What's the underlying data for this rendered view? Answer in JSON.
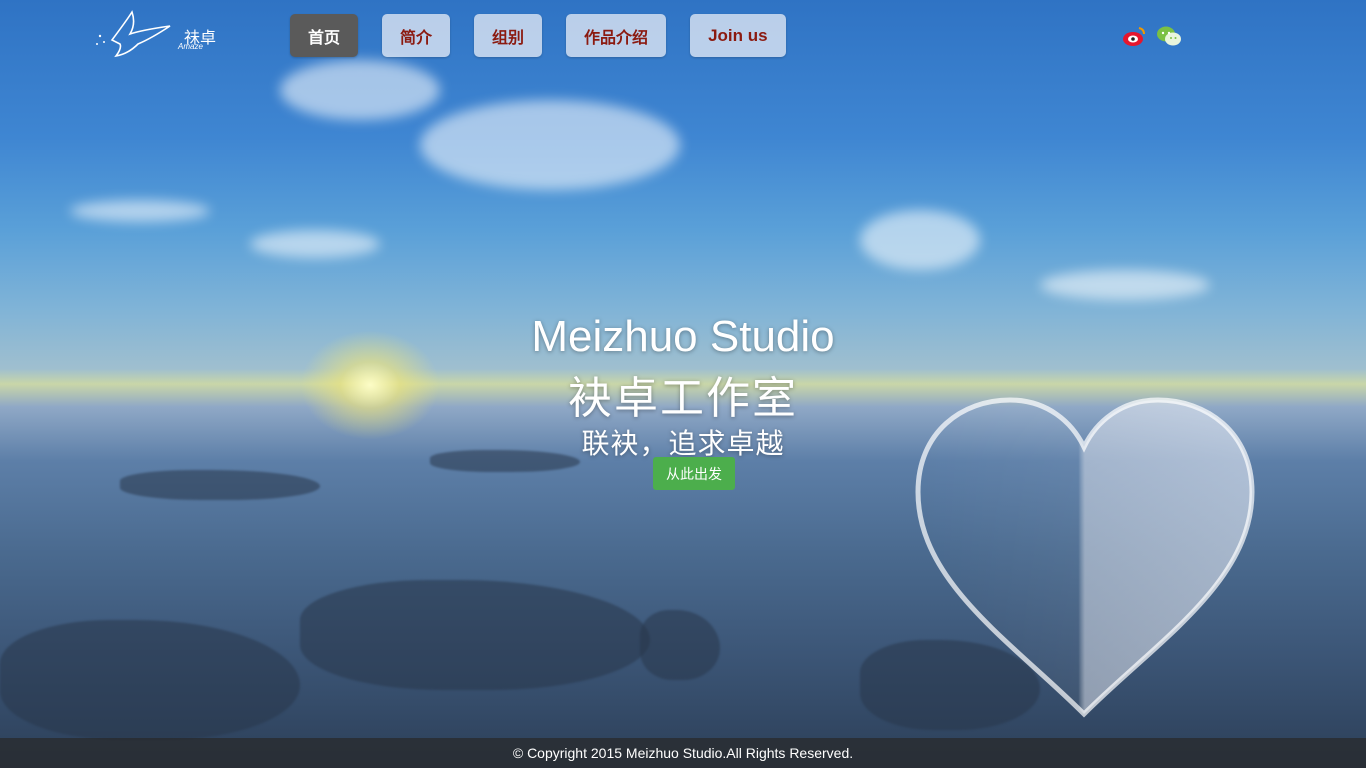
{
  "brand": {
    "logo_text": "祙卓",
    "logo_sub": "Amaze",
    "logo_icon": "bird-logo-icon"
  },
  "nav": {
    "items": [
      {
        "label": "首页",
        "active": true
      },
      {
        "label": "简介",
        "active": false
      },
      {
        "label": "组别",
        "active": false
      },
      {
        "label": "作品介绍",
        "active": false
      },
      {
        "label": "Join us",
        "active": false
      }
    ]
  },
  "social": {
    "weibo_icon": "weibo-icon",
    "wechat_icon": "wechat-icon"
  },
  "hero": {
    "title": "Meizhuo Studio",
    "subtitle": "袂卓工作室",
    "tagline": "联袂，追求卓越",
    "cta_label": "从此出发"
  },
  "footer": {
    "copyright": "© Copyright 2015 Meizhuo Studio.All Rights Reserved."
  },
  "colors": {
    "nav_text": "#8b1a10",
    "nav_active_bg": "#5a5a5a",
    "cta_bg": "#4cae4c"
  }
}
